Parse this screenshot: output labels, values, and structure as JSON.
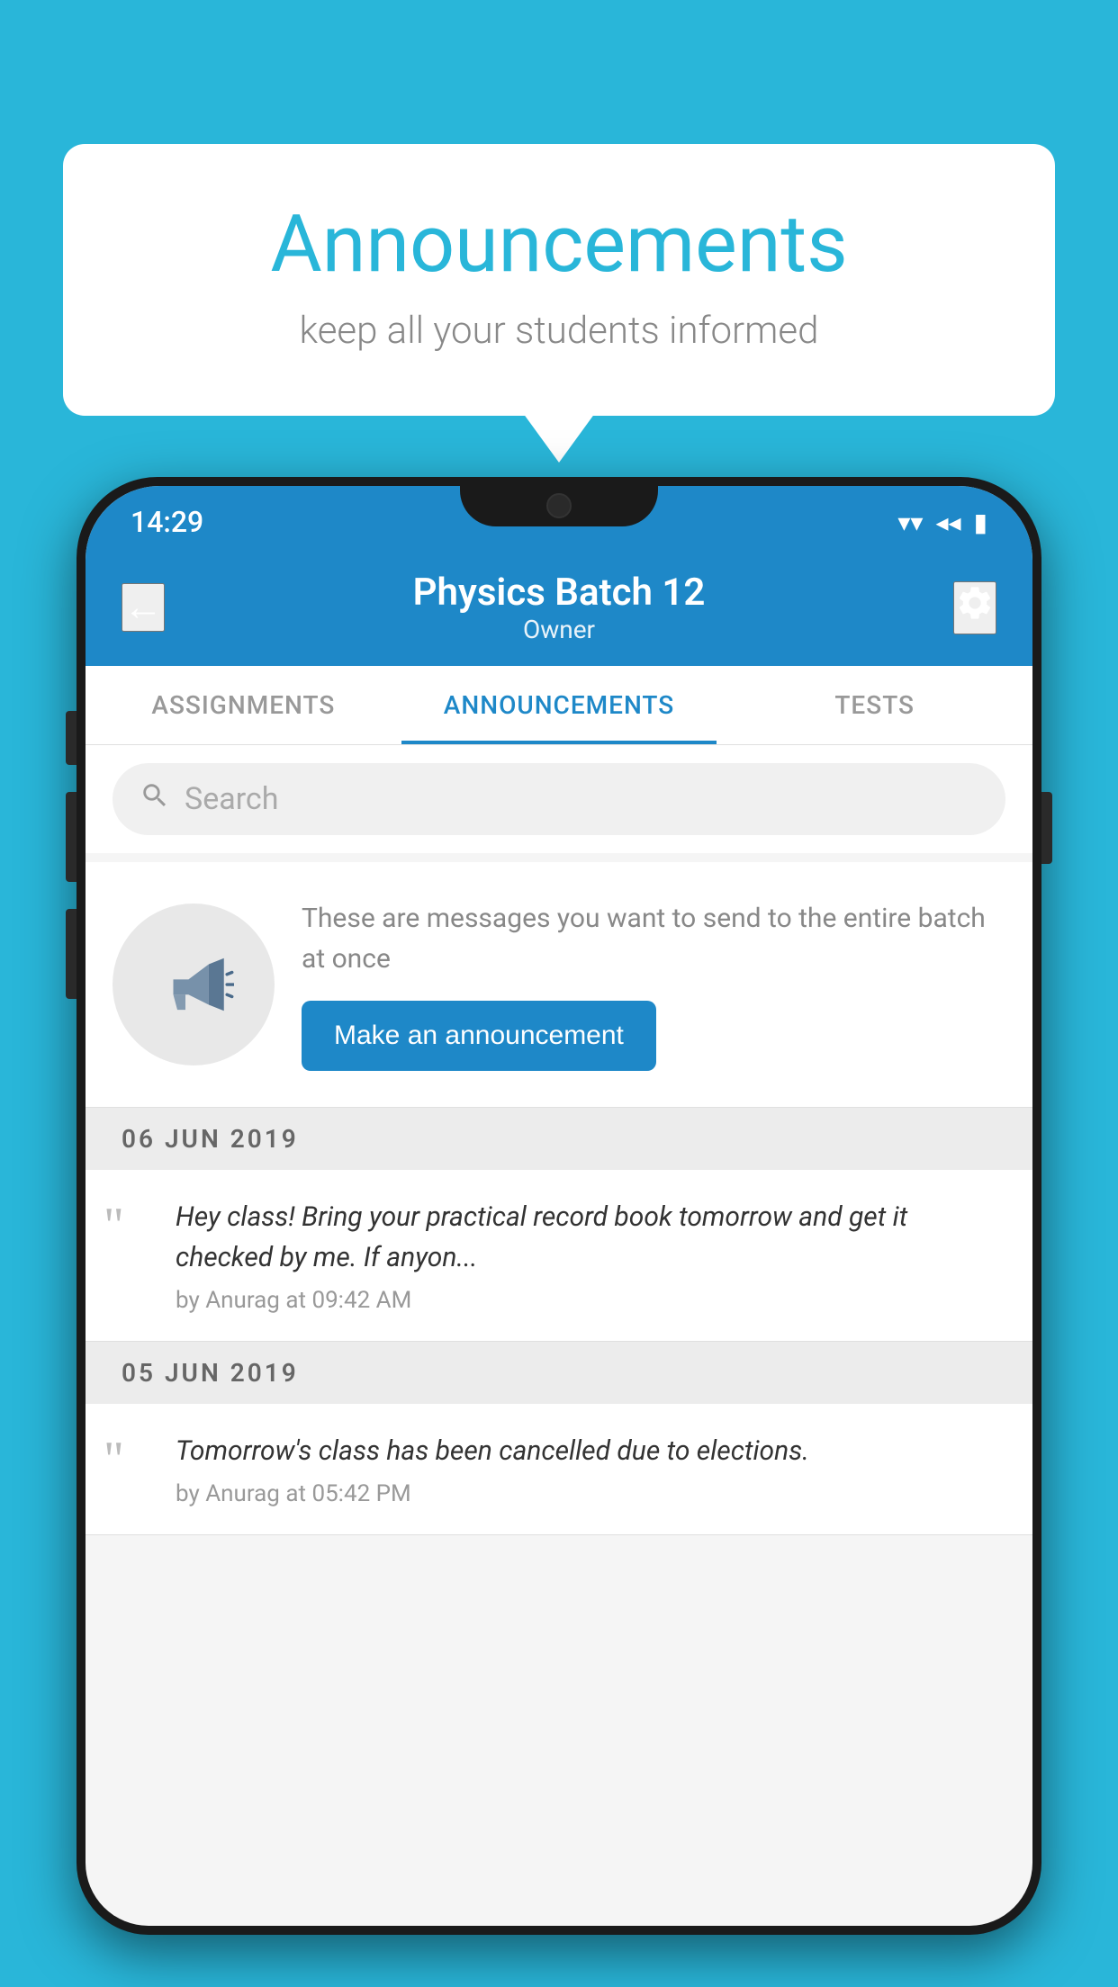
{
  "background_color": "#29b6d9",
  "speech_bubble": {
    "title": "Announcements",
    "subtitle": "keep all your students informed"
  },
  "phone": {
    "status_bar": {
      "time": "14:29",
      "wifi": "▾",
      "signal": "◂",
      "battery": "▮"
    },
    "header": {
      "back_label": "←",
      "title": "Physics Batch 12",
      "subtitle": "Owner",
      "settings_label": "⚙"
    },
    "tabs": [
      {
        "label": "ASSIGNMENTS",
        "active": false
      },
      {
        "label": "ANNOUNCEMENTS",
        "active": true
      },
      {
        "label": "TESTS",
        "active": false
      }
    ],
    "search": {
      "placeholder": "Search"
    },
    "announcement_promo": {
      "description": "These are messages you want to send to the entire batch at once",
      "button_label": "Make an announcement"
    },
    "date_sections": [
      {
        "date": "06  JUN  2019",
        "items": [
          {
            "message": "Hey class! Bring your practical record book tomorrow and get it checked by me. If anyon...",
            "author": "by Anurag at 09:42 AM"
          }
        ]
      },
      {
        "date": "05  JUN  2019",
        "items": [
          {
            "message": "Tomorrow's class has been cancelled due to elections.",
            "author": "by Anurag at 05:42 PM"
          }
        ]
      }
    ]
  }
}
